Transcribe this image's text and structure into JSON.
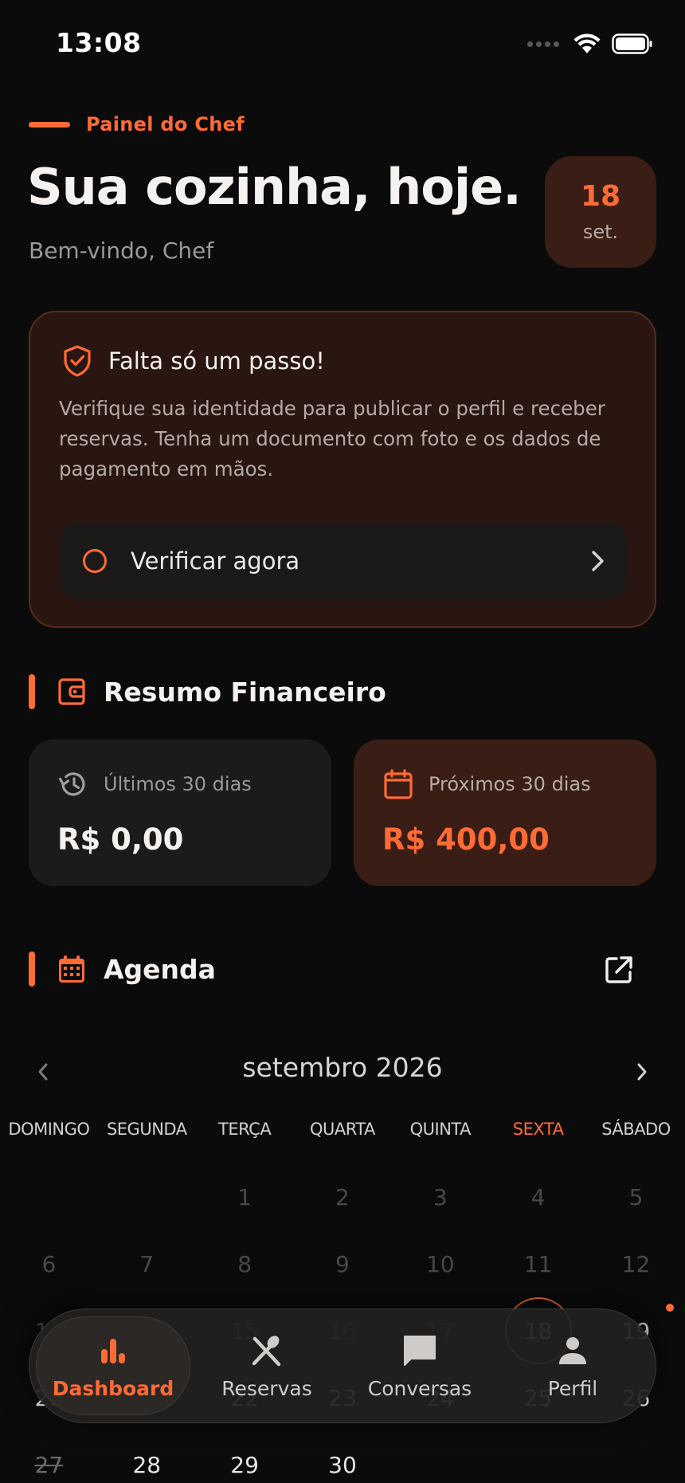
{
  "status_bar": {
    "time": "13:08"
  },
  "header": {
    "eyebrow": "Painel do Chef",
    "title": "Sua cozinha, hoje.",
    "welcome": "Bem-vindo, Chef",
    "date_day": "18",
    "date_month": "set."
  },
  "verification": {
    "title": "Falta só um passo!",
    "description": "Verifique sua identidade para publicar o perfil e receber reservas. Tenha um documento com foto e os dados de pagamento em mãos.",
    "button_label": "Verificar agora"
  },
  "finance": {
    "title": "Resumo Financeiro",
    "past": {
      "caption": "Últimos 30 dias",
      "amount": "R$ 0,00"
    },
    "future": {
      "caption": "Próximos 30 dias",
      "amount": "R$ 400,00"
    }
  },
  "agenda": {
    "title": "Agenda",
    "month_label": "setembro 2026",
    "weekdays": [
      "DOMINGO",
      "SEGUNDA",
      "TERÇA",
      "QUARTA",
      "QUINTA",
      "SEXTA",
      "SÁBADO"
    ],
    "today_weekday_index": 5,
    "weeks": [
      [
        "",
        "",
        "1",
        "2",
        "3",
        "4",
        "5"
      ],
      [
        "6",
        "7",
        "8",
        "9",
        "10",
        "11",
        "12"
      ],
      [
        "13",
        "14",
        "15",
        "16",
        "17",
        "18",
        "19"
      ],
      [
        "20",
        "21",
        "22",
        "23",
        "24",
        "25",
        "26"
      ],
      [
        "27",
        "28",
        "29",
        "30",
        "",
        "",
        ""
      ]
    ],
    "selected_day": "18",
    "event_days": [
      "19"
    ],
    "struck_days": [
      "27"
    ]
  },
  "bottom_nav": {
    "items": [
      {
        "label": "Dashboard",
        "icon": "bar-chart-icon",
        "active": true
      },
      {
        "label": "Reservas",
        "icon": "utensils-icon",
        "active": false
      },
      {
        "label": "Conversas",
        "icon": "chat-icon",
        "active": false
      },
      {
        "label": "Perfil",
        "icon": "user-icon",
        "active": false
      }
    ]
  },
  "colors": {
    "accent": "#ff6b35",
    "background": "#0c0b0b",
    "card": "#1c1b1a",
    "accent_card": "#3a1d14"
  }
}
